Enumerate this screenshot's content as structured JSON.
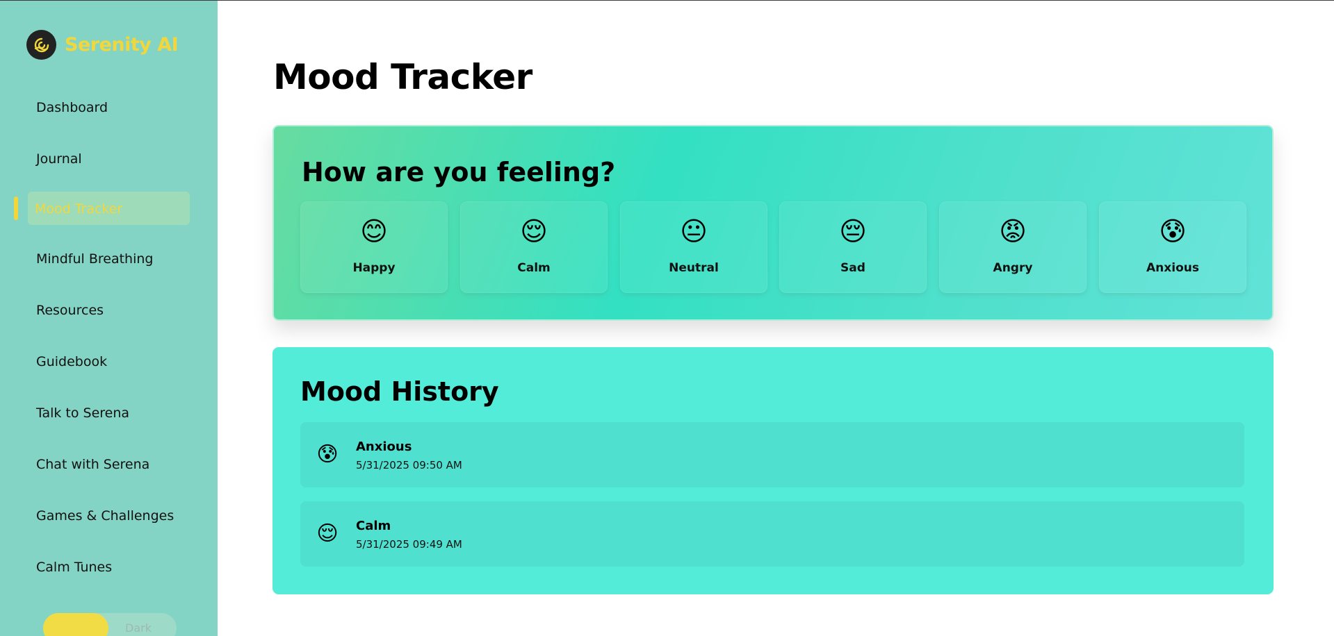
{
  "brand": {
    "name": "Serenity AI",
    "logo_icon": "wave-logo-icon"
  },
  "sidebar": {
    "items": [
      {
        "label": "Dashboard"
      },
      {
        "label": "Journal"
      },
      {
        "label": "Mood Tracker",
        "active": true
      },
      {
        "label": "Mindful Breathing"
      },
      {
        "label": "Resources"
      },
      {
        "label": "Guidebook"
      },
      {
        "label": "Talk to Serena"
      },
      {
        "label": "Chat with Serena"
      },
      {
        "label": "Games & Challenges"
      },
      {
        "label": "Calm Tunes"
      }
    ],
    "theme_toggle": {
      "dark_label": "Dark"
    }
  },
  "page": {
    "title": "Mood Tracker"
  },
  "mood_picker": {
    "title": "How are you feeling?",
    "moods": [
      {
        "label": "Happy",
        "emoji": "😊"
      },
      {
        "label": "Calm",
        "emoji": "😌"
      },
      {
        "label": "Neutral",
        "emoji": "😐"
      },
      {
        "label": "Sad",
        "emoji": "😔"
      },
      {
        "label": "Angry",
        "emoji": "😡"
      },
      {
        "label": "Anxious",
        "emoji": "😰"
      }
    ]
  },
  "history": {
    "title": "Mood History",
    "entries": [
      {
        "mood": "Anxious",
        "emoji": "😰",
        "time": "5/31/2025 09:50 AM"
      },
      {
        "mood": "Calm",
        "emoji": "😌",
        "time": "5/31/2025 09:49 AM"
      }
    ]
  },
  "colors": {
    "sidebar_bg": "#84d4c5",
    "accent_yellow": "#f2d73c",
    "history_bg": "#53ecd8"
  }
}
